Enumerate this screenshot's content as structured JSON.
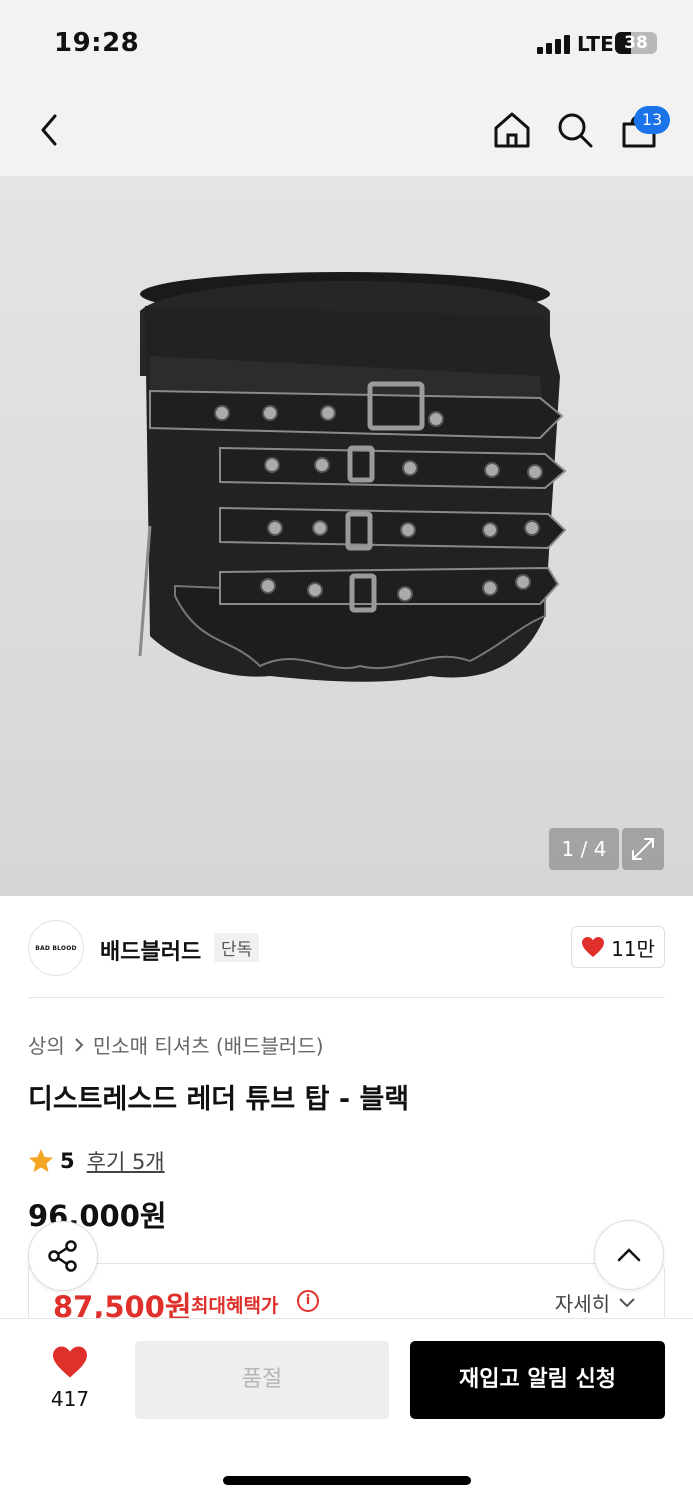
{
  "status_bar": {
    "time": "19:28",
    "network": "LTE",
    "battery": "38",
    "battery_level": 0.38
  },
  "header": {
    "back_icon": "chevron-left-icon",
    "home_icon": "home-icon",
    "search_icon": "search-icon",
    "bag_icon": "shopping-bag-icon",
    "cart_count": "13",
    "badge_color": "#1a73e8"
  },
  "gallery": {
    "counter": "1 / 4",
    "expand_icon": "expand-icon"
  },
  "brand": {
    "logo_text": "BAD BLOOD",
    "name": "배드블러드",
    "tag": "단독",
    "like_count": "11만",
    "like_icon": "heart-icon"
  },
  "product": {
    "breadcrumb": [
      "상의",
      "민소매 티셔츠 (배드블러드)"
    ],
    "title": "디스트레스드 레더 튜브 탑 - 블랙",
    "rating": "5",
    "rating_score": 5,
    "reviews_label": "후기 5개",
    "price": "96,000원",
    "benefit_price": "87,500원",
    "benefit_label": "최대혜택가",
    "benefit_info": "i",
    "detail_label": "자세히",
    "accent_color": "#e0302b"
  },
  "bottom_bar": {
    "wish_count": "417",
    "soldout_label": "품절",
    "restock_label": "재입고 알림 신청"
  }
}
